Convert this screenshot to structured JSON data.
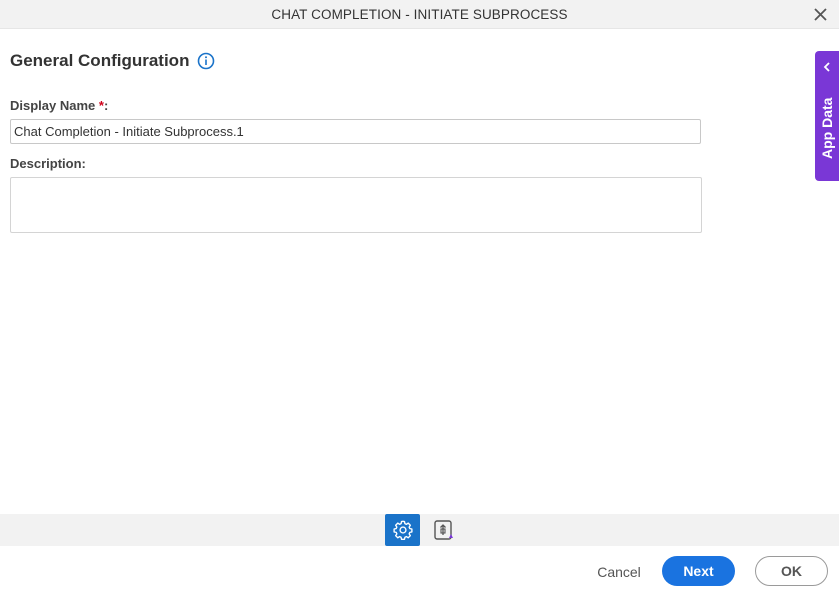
{
  "dialog": {
    "title": "CHAT COMPLETION - INITIATE SUBPROCESS"
  },
  "section": {
    "title": "General Configuration"
  },
  "fields": {
    "display_name": {
      "label": "Display Name",
      "required_marker": "*",
      "colon": ":",
      "value": "Chat Completion - Initiate Subprocess.1"
    },
    "description": {
      "label": "Description:",
      "value": ""
    }
  },
  "side_panel": {
    "label": "App Data"
  },
  "footer": {
    "cancel_label": "Cancel",
    "next_label": "Next",
    "ok_label": "OK"
  },
  "colors": {
    "primary": "#1a73e0",
    "side_panel": "#7a37d6",
    "required": "#d0021b"
  },
  "icons": {
    "close": "close-icon",
    "info": "info-icon",
    "chevron": "chevron-left-icon",
    "settings": "gear-icon",
    "app_data": "data-document-icon"
  }
}
